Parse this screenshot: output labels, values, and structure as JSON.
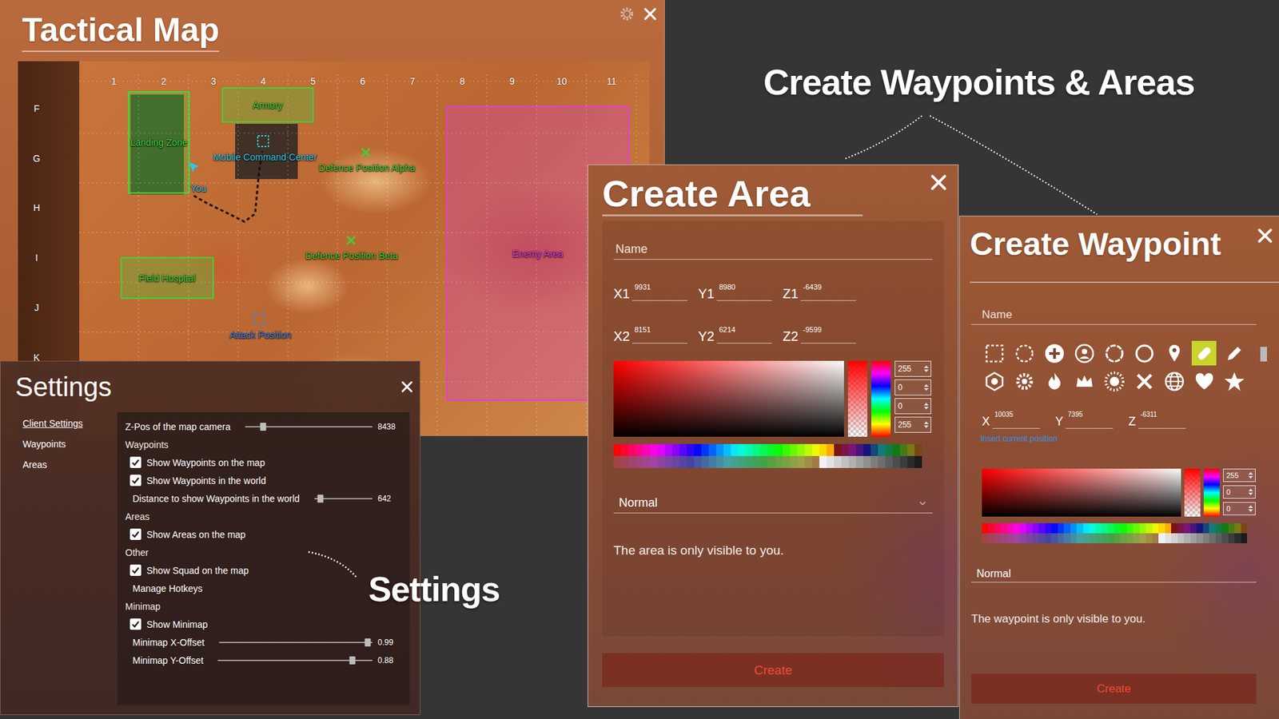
{
  "map_window": {
    "title": "Tactical Map",
    "columns": [
      "1",
      "2",
      "3",
      "4",
      "5",
      "6",
      "7",
      "8",
      "9",
      "10",
      "11"
    ],
    "rows": [
      "F",
      "G",
      "H",
      "I",
      "J",
      "K"
    ],
    "areas": [
      {
        "label": "Landing Zone",
        "color": "#43d63c"
      },
      {
        "label": "Armory",
        "color": "#3fd13a"
      },
      {
        "label": "Field Hospital",
        "color": "#3fd13a"
      },
      {
        "label": "Enemy Area",
        "color": "#e03fd8"
      }
    ],
    "waypoints": [
      {
        "label": "Mobile Command Center",
        "kind": "square",
        "color": "#2ec7e8"
      },
      {
        "label": "Defence Position Alpha",
        "kind": "cross",
        "color": "#3fd13a"
      },
      {
        "label": "Defence Position Beta",
        "kind": "cross",
        "color": "#3fd13a"
      },
      {
        "label": "Attack Position",
        "kind": "square",
        "color": "#3f82e0"
      }
    ],
    "player": {
      "label": "You",
      "color": "#2ec7e8"
    }
  },
  "settings": {
    "title": "Settings",
    "nav": [
      {
        "label": "Client Settings",
        "selected": true
      },
      {
        "label": "Waypoints",
        "selected": false
      },
      {
        "label": "Areas",
        "selected": false
      }
    ],
    "rows": [
      {
        "kind": "slider",
        "label": "Z-Pos of the map camera",
        "level": 0.14,
        "value": "8438"
      },
      {
        "kind": "section",
        "label": "Waypoints"
      },
      {
        "kind": "checkbox",
        "label": "Show Waypoints on the map",
        "checked": true
      },
      {
        "kind": "checkbox",
        "label": "Show Waypoints in the world",
        "checked": true
      },
      {
        "kind": "slider",
        "label": "Distance to show Waypoints in the world",
        "level": 0.1,
        "value": "642"
      },
      {
        "kind": "section",
        "label": "Areas"
      },
      {
        "kind": "checkbox",
        "label": "Show Areas on the map",
        "checked": true
      },
      {
        "kind": "section",
        "label": "Other"
      },
      {
        "kind": "checkbox",
        "label": "Show Squad on the map",
        "checked": true
      },
      {
        "kind": "button",
        "label": "Manage Hotkeys"
      },
      {
        "kind": "section",
        "label": "Minimap"
      },
      {
        "kind": "checkbox",
        "label": "Show Minimap",
        "checked": true
      },
      {
        "kind": "slider",
        "label": "Minimap X-Offset",
        "level": 0.97,
        "value": "0.99"
      },
      {
        "kind": "slider",
        "label": "Minimap Y-Offset",
        "level": 0.87,
        "value": "0.88"
      }
    ]
  },
  "captions": {
    "create": "Create Waypoints & Areas",
    "settings": "Settings"
  },
  "create_area": {
    "title": "Create Area",
    "name_placeholder": "Name",
    "coords": [
      {
        "label": "X1",
        "value": "9931"
      },
      {
        "label": "Y1",
        "value": "8980"
      },
      {
        "label": "Z1",
        "value": "-6439"
      },
      {
        "label": "X2",
        "value": "8151"
      },
      {
        "label": "Y2",
        "value": "6214"
      },
      {
        "label": "Z2",
        "value": "-9599"
      }
    ],
    "channels": [
      "255",
      "0",
      "0",
      "255"
    ],
    "mode": "Normal",
    "note": "The area is only visible to you.",
    "button": "Create"
  },
  "create_waypoint": {
    "title": "Create Waypoint",
    "name_placeholder": "Name",
    "icons": [
      {
        "kind": "dashed-square",
        "selected": false
      },
      {
        "kind": "dashed-circle",
        "selected": false
      },
      {
        "kind": "plus",
        "selected": false
      },
      {
        "kind": "face",
        "selected": false
      },
      {
        "kind": "ring",
        "selected": false
      },
      {
        "kind": "circle",
        "selected": false
      },
      {
        "kind": "pin",
        "selected": false
      },
      {
        "kind": "bandage",
        "selected": true
      },
      {
        "kind": "pencil",
        "selected": false
      },
      {
        "kind": "bar",
        "selected": false
      },
      {
        "kind": "hexagon",
        "selected": false
      },
      {
        "kind": "gear",
        "selected": false
      },
      {
        "kind": "flame",
        "selected": false
      },
      {
        "kind": "crown",
        "selected": false
      },
      {
        "kind": "sun",
        "selected": false
      },
      {
        "kind": "cross",
        "selected": false
      },
      {
        "kind": "globe",
        "selected": false
      },
      {
        "kind": "heart",
        "selected": false
      },
      {
        "kind": "star",
        "selected": false
      }
    ],
    "coords": [
      {
        "label": "X",
        "value": "10035"
      },
      {
        "label": "Y",
        "value": "7395"
      },
      {
        "label": "Z",
        "value": "-6311"
      }
    ],
    "insert_link": "Insert current position",
    "channels": [
      "255",
      "0",
      "0"
    ],
    "mode": "Normal",
    "note": "The waypoint is only visible to you.",
    "button": "Create"
  }
}
